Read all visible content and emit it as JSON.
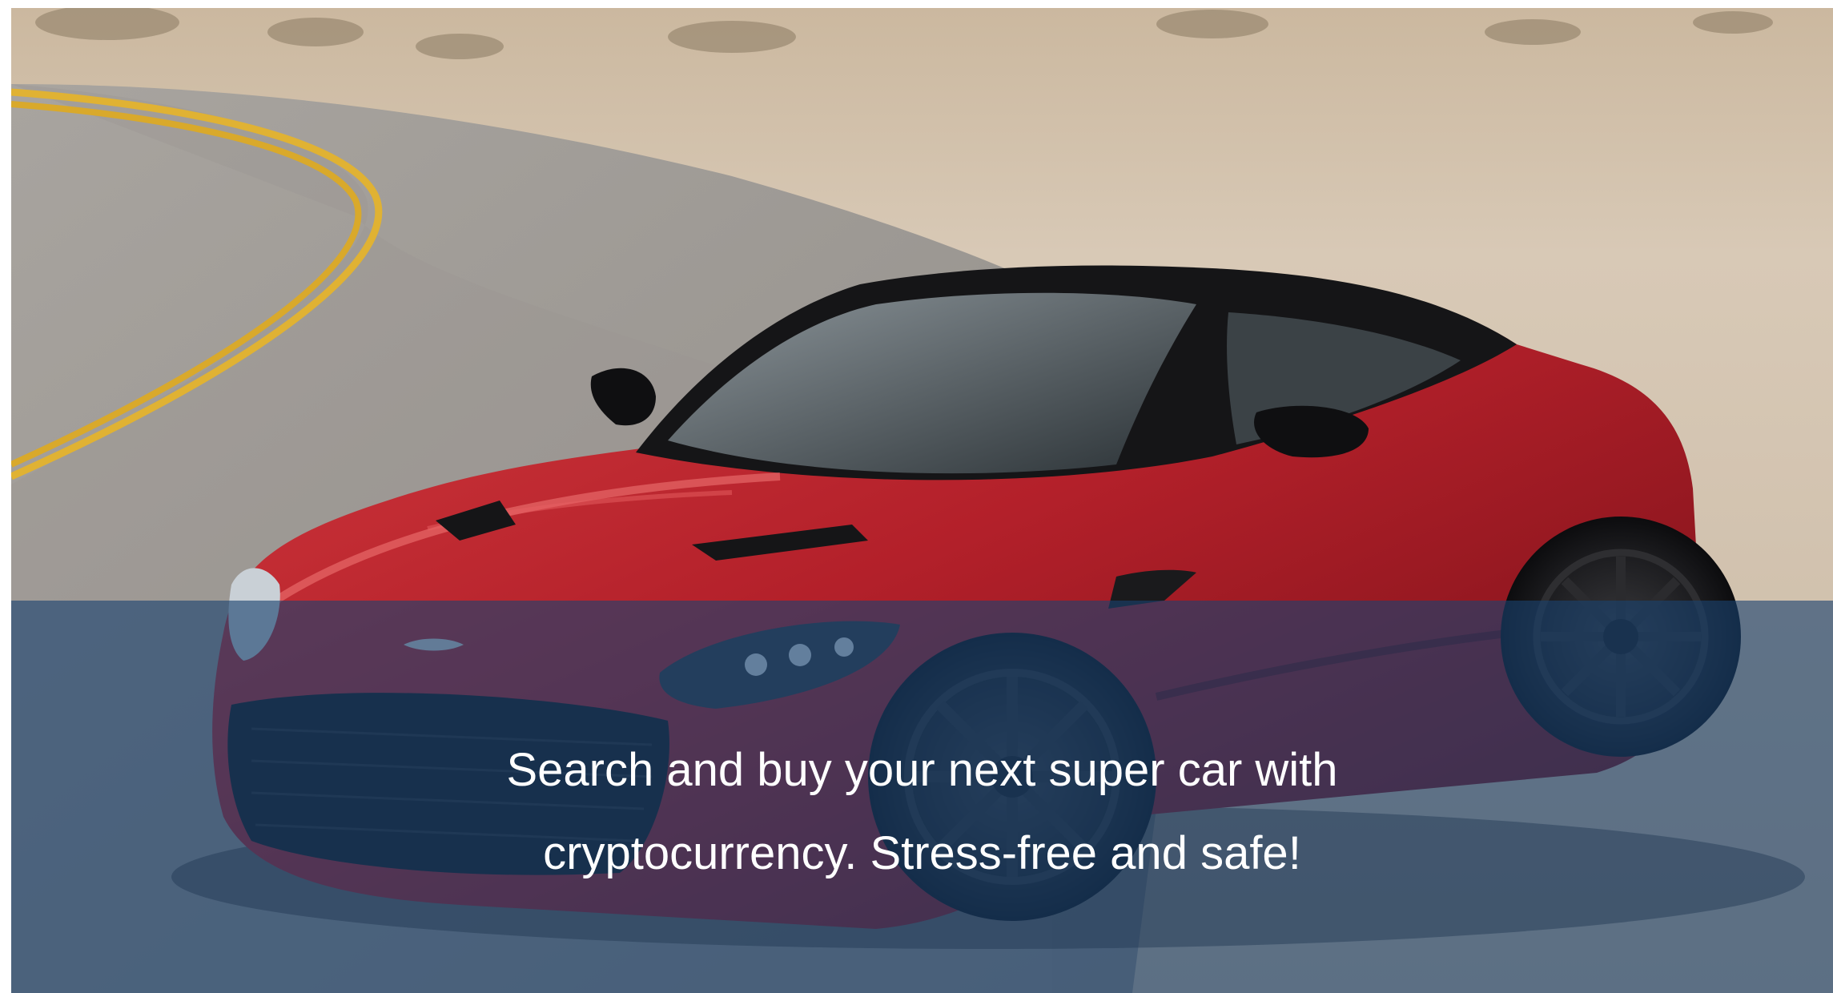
{
  "hero": {
    "image": {
      "subject": "red-sports-car-on-desert-road",
      "colors": {
        "sky_sand": "#d8c9b6",
        "asphalt": "#9c9893",
        "road_line": "#e0b233",
        "car_body": "#b3202a",
        "car_body_dark": "#6b0d14",
        "car_roof": "#151517"
      }
    },
    "caption": {
      "line1": "Search and buy your next super car with",
      "line2": "cryptocurrency. Stress-free and safe!"
    },
    "overlay_color": "#1a4270"
  }
}
